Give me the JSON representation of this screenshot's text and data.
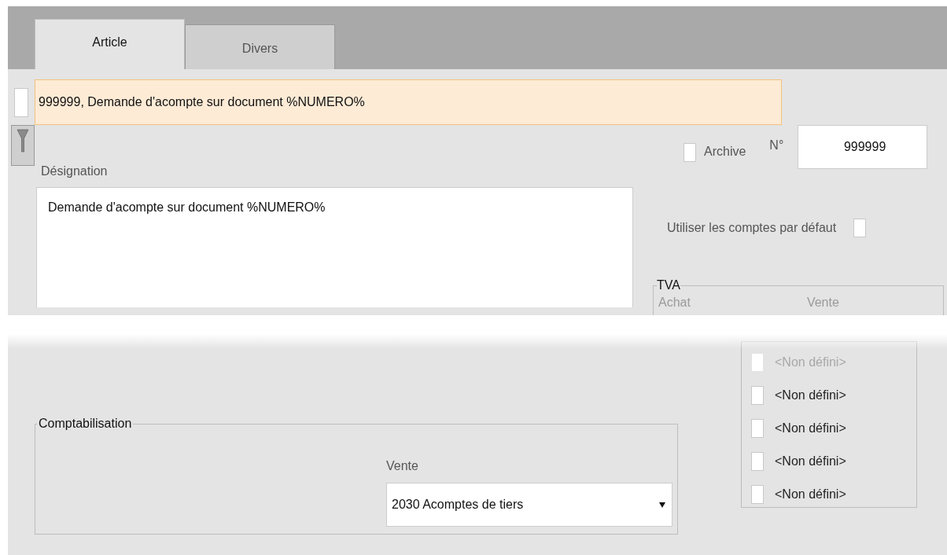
{
  "tabs": [
    {
      "label": "Article",
      "selected": true
    },
    {
      "label": "Divers",
      "selected": false
    }
  ],
  "record": {
    "checked": false,
    "title": "999999, Demande d'acompte sur document %NUMERO%"
  },
  "designation": {
    "label": "Désignation",
    "value": "Demande d'acompte sur document %NUMERO%"
  },
  "archive": {
    "label": "Archive",
    "checked": false
  },
  "number": {
    "label": "N°",
    "value": "999999"
  },
  "default_accounts": {
    "label": "Utiliser les comptes par défaut",
    "checked": false
  },
  "tva": {
    "title": "TVA",
    "columns": [
      "Achat",
      "Vente"
    ],
    "vente_items": [
      {
        "label": "<Non défini>",
        "checked": false
      },
      {
        "label": "<Non défini>",
        "checked": false
      },
      {
        "label": "<Non défini>",
        "checked": false
      },
      {
        "label": "<Non défini>",
        "checked": false
      },
      {
        "label": "<Non défini>",
        "checked": false
      }
    ]
  },
  "comptabilisation": {
    "title": "Comptabilisation",
    "vente_label": "Vente",
    "vente_value": "2030 Acomptes de tiers"
  }
}
